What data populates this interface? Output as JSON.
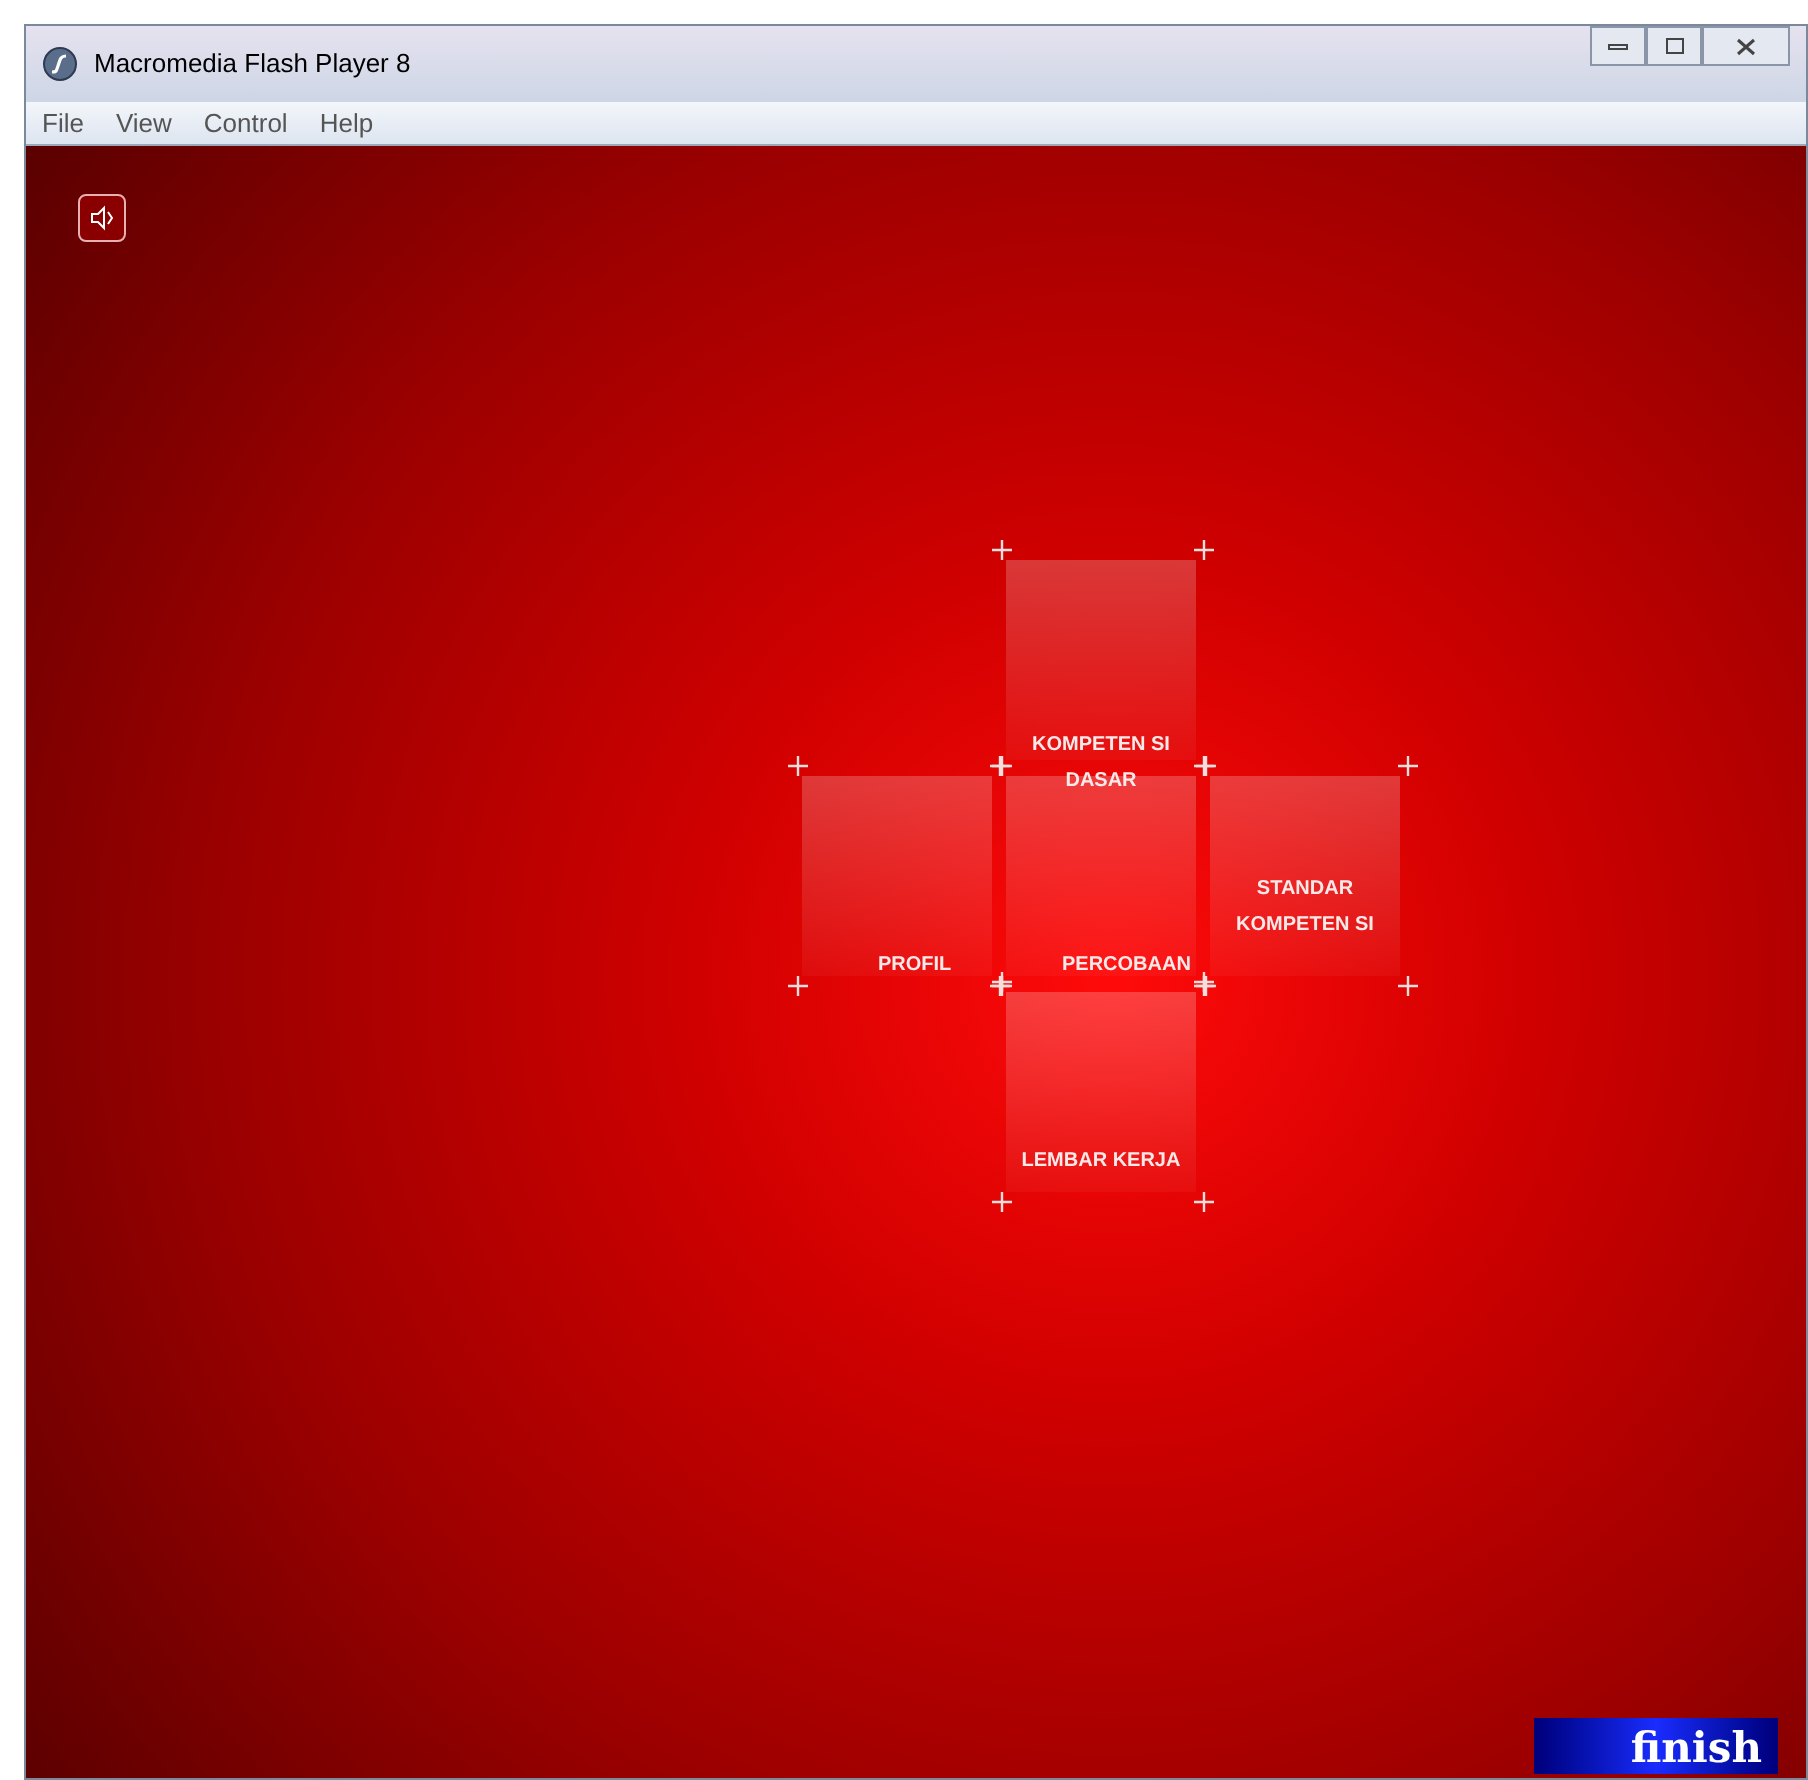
{
  "window": {
    "title": "Macromedia Flash Player 8"
  },
  "menu": [
    "File",
    "View",
    "Control",
    "Help"
  ],
  "tiles": [
    {
      "label": "KOMPETEN SI DASAR",
      "kind": "top"
    },
    {
      "label": "PROFIL",
      "kind": "left"
    },
    {
      "label": "PERCOBAAN",
      "kind": "center"
    },
    {
      "label": "STANDAR KOMPETEN SI",
      "kind": "right"
    },
    {
      "label": "LEMBAR KERJA",
      "kind": "bottom"
    }
  ],
  "finish_button": "finish"
}
